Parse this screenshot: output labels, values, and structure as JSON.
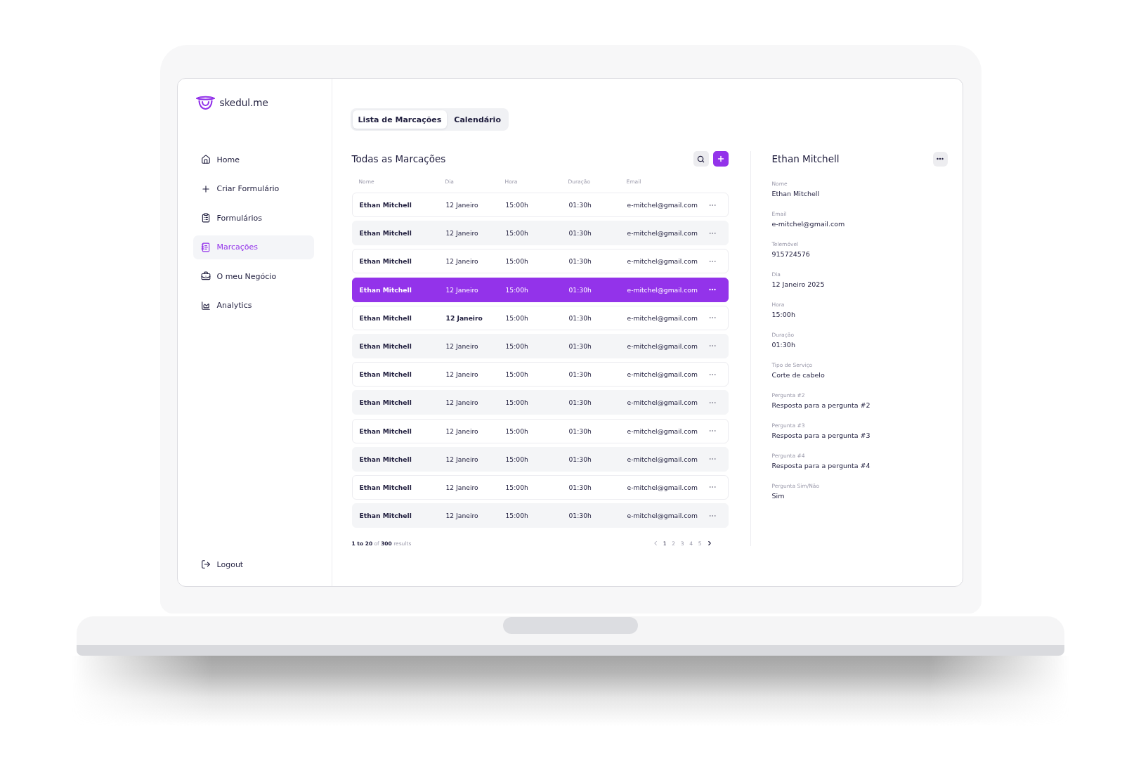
{
  "brand": {
    "name": "skedul.me"
  },
  "sidebar": {
    "items": [
      {
        "label": "Home",
        "selected": false
      },
      {
        "label": "Criar Formulário",
        "selected": false
      },
      {
        "label": "Formulários",
        "selected": false
      },
      {
        "label": "Marcações",
        "selected": true
      },
      {
        "label": "O meu Negócio",
        "selected": false
      },
      {
        "label": "Analytics",
        "selected": false
      }
    ],
    "logout": {
      "label": "Logout"
    }
  },
  "tabs": [
    {
      "label": "Lista de Marcações",
      "selected": true
    },
    {
      "label": "Calendário",
      "selected": false
    }
  ],
  "list": {
    "title": "Todas as Marcações",
    "columns": [
      "Nome",
      "Dia",
      "Hora",
      "Duração",
      "Email"
    ],
    "rows": [
      {
        "cells": [
          {
            "text": "Ethan Mitchell",
            "bold": true
          },
          {
            "text": "12 Janeiro",
            "bold": false
          },
          {
            "text": "15:00h",
            "bold": false
          },
          {
            "text": "01:30h",
            "bold": false
          },
          {
            "text": "e-mitchel@gmail.com",
            "bold": false
          }
        ],
        "selected": false
      },
      {
        "cells": [
          {
            "text": "Ethan Mitchell",
            "bold": true
          },
          {
            "text": "12 Janeiro",
            "bold": false
          },
          {
            "text": "15:00h",
            "bold": false
          },
          {
            "text": "01:30h",
            "bold": false
          },
          {
            "text": "e-mitchel@gmail.com",
            "bold": false
          }
        ],
        "selected": false
      },
      {
        "cells": [
          {
            "text": "Ethan Mitchell",
            "bold": true
          },
          {
            "text": "12 Janeiro",
            "bold": false
          },
          {
            "text": "15:00h",
            "bold": false
          },
          {
            "text": "01:30h",
            "bold": false
          },
          {
            "text": "e-mitchel@gmail.com",
            "bold": false
          }
        ],
        "selected": false
      },
      {
        "cells": [
          {
            "text": "Ethan Mitchell",
            "bold": true
          },
          {
            "text": "12 Janeiro",
            "bold": false
          },
          {
            "text": "15:00h",
            "bold": false
          },
          {
            "text": "01:30h",
            "bold": false
          },
          {
            "text": "e-mitchel@gmail.com",
            "bold": false
          }
        ],
        "selected": true
      },
      {
        "cells": [
          {
            "text": "Ethan Mitchell",
            "bold": true
          },
          {
            "text": "12 Janeiro",
            "bold": true
          },
          {
            "text": "15:00h",
            "bold": false
          },
          {
            "text": "01:30h",
            "bold": false
          },
          {
            "text": "e-mitchel@gmail.com",
            "bold": false
          }
        ],
        "selected": false
      },
      {
        "cells": [
          {
            "text": "Ethan Mitchell",
            "bold": true
          },
          {
            "text": "12 Janeiro",
            "bold": false
          },
          {
            "text": "15:00h",
            "bold": false
          },
          {
            "text": "01:30h",
            "bold": false
          },
          {
            "text": "e-mitchel@gmail.com",
            "bold": false
          }
        ],
        "selected": false
      },
      {
        "cells": [
          {
            "text": "Ethan Mitchell",
            "bold": true
          },
          {
            "text": "12 Janeiro",
            "bold": false
          },
          {
            "text": "15:00h",
            "bold": false
          },
          {
            "text": "01:30h",
            "bold": false
          },
          {
            "text": "e-mitchel@gmail.com",
            "bold": false
          }
        ],
        "selected": false
      },
      {
        "cells": [
          {
            "text": "Ethan Mitchell",
            "bold": true
          },
          {
            "text": "12 Janeiro",
            "bold": false
          },
          {
            "text": "15:00h",
            "bold": false
          },
          {
            "text": "01:30h",
            "bold": false
          },
          {
            "text": "e-mitchel@gmail.com",
            "bold": false
          }
        ],
        "selected": false
      },
      {
        "cells": [
          {
            "text": "Ethan Mitchell",
            "bold": true
          },
          {
            "text": "12 Janeiro",
            "bold": false
          },
          {
            "text": "15:00h",
            "bold": false
          },
          {
            "text": "01:30h",
            "bold": false
          },
          {
            "text": "e-mitchel@gmail.com",
            "bold": false
          }
        ],
        "selected": false
      },
      {
        "cells": [
          {
            "text": "Ethan Mitchell",
            "bold": true
          },
          {
            "text": "12 Janeiro",
            "bold": false
          },
          {
            "text": "15:00h",
            "bold": false
          },
          {
            "text": "01:30h",
            "bold": false
          },
          {
            "text": "e-mitchel@gmail.com",
            "bold": false
          }
        ],
        "selected": false
      },
      {
        "cells": [
          {
            "text": "Ethan Mitchell",
            "bold": true
          },
          {
            "text": "12 Janeiro",
            "bold": false
          },
          {
            "text": "15:00h",
            "bold": false
          },
          {
            "text": "01:30h",
            "bold": false
          },
          {
            "text": "e-mitchel@gmail.com",
            "bold": false
          }
        ],
        "selected": false
      },
      {
        "cells": [
          {
            "text": "Ethan Mitchell",
            "bold": true
          },
          {
            "text": "12 Janeiro",
            "bold": false
          },
          {
            "text": "15:00h",
            "bold": false
          },
          {
            "text": "01:30h",
            "bold": false
          },
          {
            "text": "e-mitchel@gmail.com",
            "bold": false
          }
        ],
        "selected": false
      }
    ],
    "pagination": {
      "summary": "**1 to 20** of **300** results",
      "prev": {
        "disabled": true
      },
      "pages": [
        {
          "label": "1",
          "selected": true
        },
        {
          "label": "2",
          "selected": false
        },
        {
          "label": "3",
          "selected": false
        },
        {
          "label": "4",
          "selected": false
        },
        {
          "label": "5",
          "selected": false
        }
      ],
      "next": {
        "disabled": false
      }
    }
  },
  "detail": {
    "title": "Ethan Mitchell",
    "fields": [
      {
        "label": "Nome",
        "value": "Ethan Mitchell"
      },
      {
        "label": "Email",
        "value": "e-mitchel@gmail.com"
      },
      {
        "label": "Telemóvel",
        "value": "915724576"
      },
      {
        "label": "Dia",
        "value": "12 Janeiro 2025"
      },
      {
        "label": "Hora",
        "value": "15:00h"
      },
      {
        "label": "Duração",
        "value": "01:30h"
      },
      {
        "label": "Tipo de Serviço",
        "value": "Corte de cabelo"
      },
      {
        "label": "Pergunta #2",
        "value": "Resposta para a pergunta #2"
      },
      {
        "label": "Pergunta #3",
        "value": "Resposta para a pergunta #3"
      },
      {
        "label": "Pergunta #4",
        "value": "Resposta para a pergunta #4"
      },
      {
        "label": "Pergunta Sim/Não",
        "value": "Sim"
      }
    ]
  }
}
